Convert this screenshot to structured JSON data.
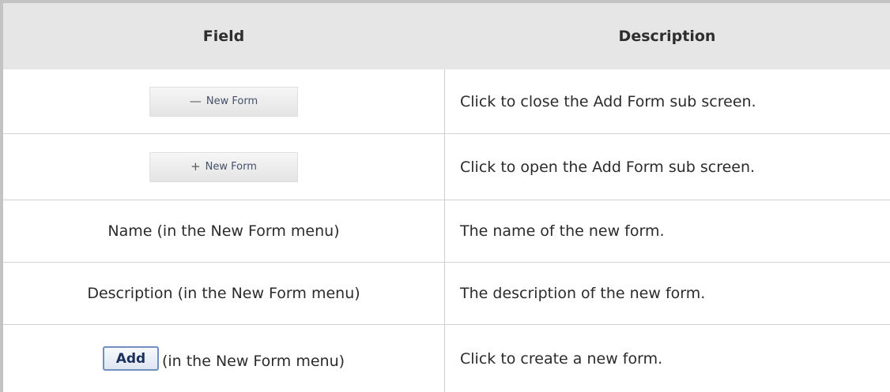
{
  "header": {
    "field": "Field",
    "description": "Description"
  },
  "rows": [
    {
      "button": {
        "label": "New Form",
        "icon": "minus-icon",
        "icon_glyph": "—"
      },
      "description": "Click to close the Add Form sub screen."
    },
    {
      "button": {
        "label": "New Form",
        "icon": "plus-icon",
        "icon_glyph": "+"
      },
      "description": "Click to open the Add Form sub screen."
    },
    {
      "field": "Name (in the New Form menu)",
      "description": "The name of the new form."
    },
    {
      "field": "Description (in the New Form menu)",
      "description": "The description of the new form."
    },
    {
      "button": {
        "label": "Add"
      },
      "field_suffix": "(in the New Form menu)",
      "description": "Click to create a new form."
    }
  ]
}
